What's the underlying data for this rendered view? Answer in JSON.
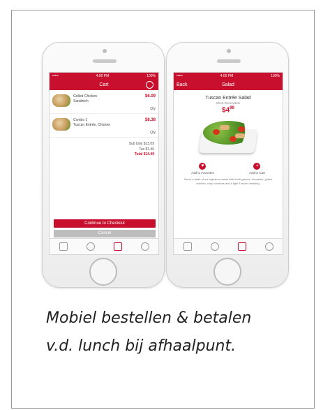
{
  "caption": {
    "line1": "Mobiel bestellen & betalen",
    "line2": "v.d. lunch bij afhaalpunt."
  },
  "left_phone": {
    "status": {
      "carrier": "•••••",
      "time": "4:00 PM",
      "battery": "100%"
    },
    "nav_title": "Cart",
    "items": [
      {
        "name": "Grilled Chicken",
        "detail": "Sandwich",
        "price": "$6.09",
        "qty": "Qty"
      },
      {
        "name": "Combo 1",
        "detail": "Tuscan Entrée, Chicken",
        "price": "$8.38",
        "qty": "Qty"
      }
    ],
    "totals": {
      "subtotal": "Sub total  $13.09",
      "tax": "Tax  $1.40",
      "total": "Total  $14.49"
    },
    "checkout_label": "Continue to Checkout",
    "cancel_label": "Cancel"
  },
  "right_phone": {
    "status": {
      "carrier": "•••••",
      "time": "4:00 PM",
      "battery": "100%"
    },
    "back_label": "Back",
    "nav_title": "Salad",
    "title": "Tuscan Entrée Salad",
    "subtitle": "Short Description",
    "price": "$4",
    "price_cents": "99",
    "action_fav": "Add to Favorites",
    "action_cart": "Add to Cart",
    "description": "Savor a taste of our signature salad with fresh greens, tomatoes, grilled chicken, crisp croutons and a light Tuscan dressing."
  },
  "colors": {
    "brand_red": "#c8102e"
  }
}
